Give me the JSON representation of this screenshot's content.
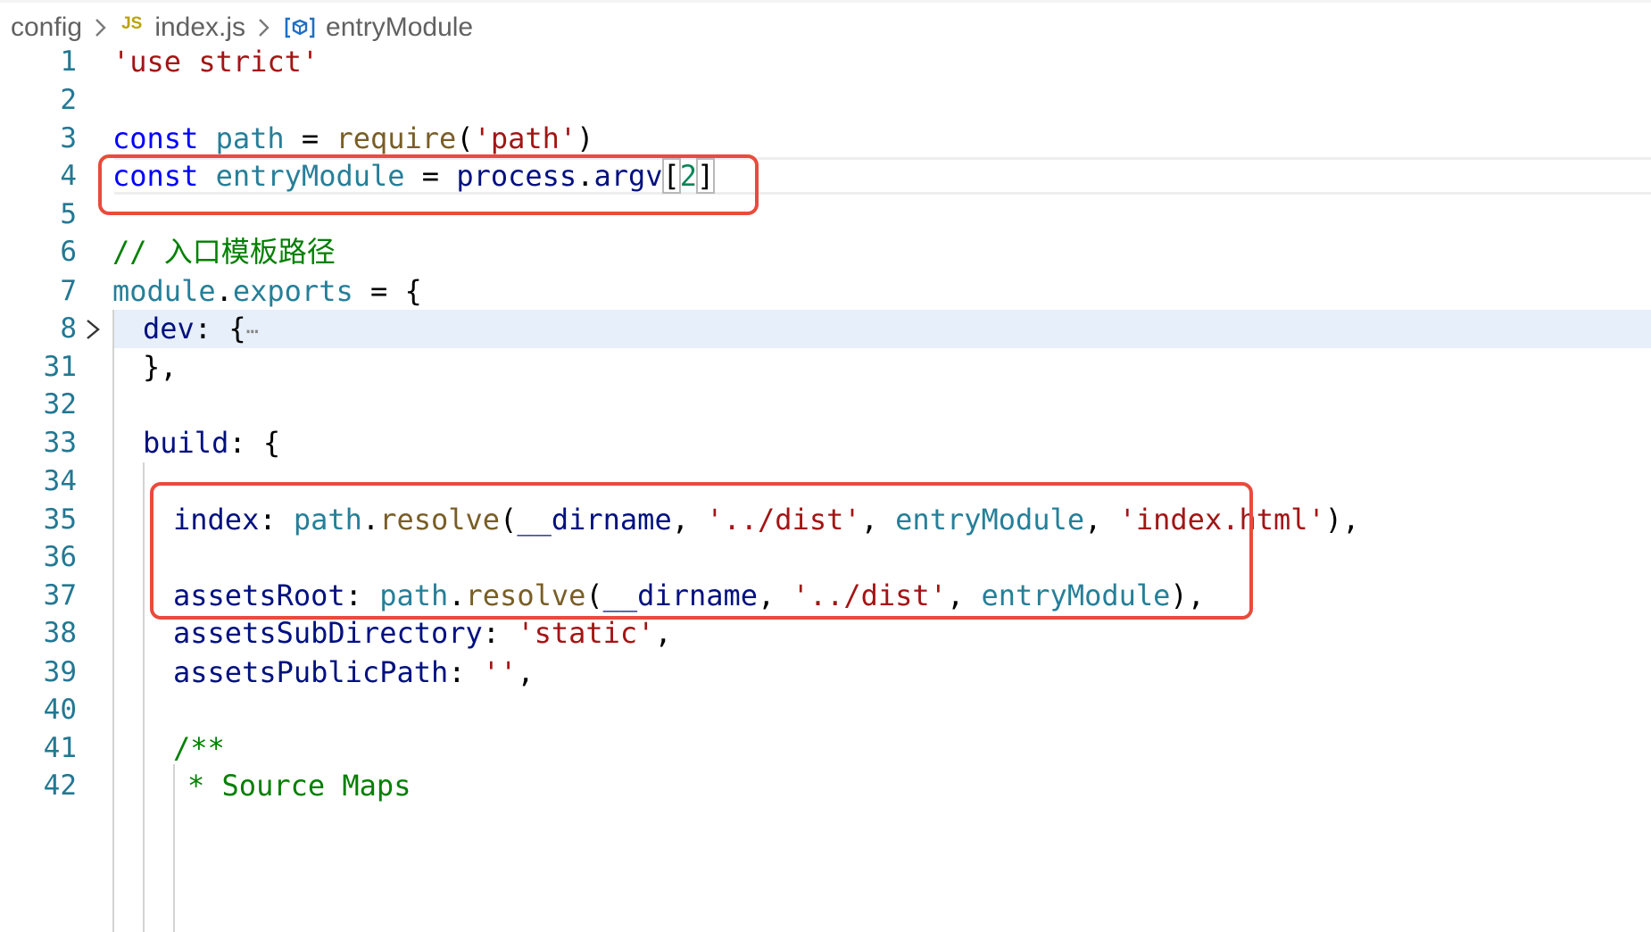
{
  "breadcrumb": {
    "folder": "config",
    "js_icon": "JS",
    "file": "index.js",
    "symbol": "entryModule"
  },
  "line_numbers": [
    "1",
    "2",
    "3",
    "4",
    "5",
    "6",
    "7",
    "8",
    "31",
    "32",
    "33",
    "34",
    "35",
    "36",
    "37",
    "38",
    "39",
    "40",
    "41",
    "42"
  ],
  "code": {
    "l1_str": "'use strict'",
    "kw_const": "const",
    "l3_var": "path",
    "l3_eq": " = ",
    "l3_fn": "require",
    "l3_open": "(",
    "l3_str": "'path'",
    "l3_close": ")",
    "l4_var": "entryModule",
    "l4_eq": " = ",
    "l4_obj": "process",
    "dot": ".",
    "l4_prop": "argv",
    "l4_lb": "[",
    "l4_num": "2",
    "l4_rb": "]",
    "l6_cmt": "// 入口模板路径",
    "l7_obj": "module",
    "l7_prop": "exports",
    "l7_rest": " = {",
    "l8_key": "dev",
    "l8_rest": ": {",
    "l8_ellipsis": "⋯",
    "l31_text": "},",
    "l33_key": "build",
    "l33_rest": ": {",
    "l35_key": "index",
    "l35_colon": ": ",
    "l35_obj": "path",
    "l35_fn": "resolve",
    "l35_open": "(",
    "l35_arg1": "__dirname",
    "comma": ", ",
    "l35_str1": "'../dist'",
    "l35_arg3": "entryModule",
    "l35_str2": "'index.html'",
    "l35_close": "),",
    "l37_key": "assetsRoot",
    "l37_colon": ": ",
    "l37_obj": "path",
    "l37_fn": "resolve",
    "l37_open": "(",
    "l37_arg1": "__dirname",
    "l37_str1": "'../dist'",
    "l37_arg3": "entryModule",
    "l37_close": "),",
    "l38_key": "assetsSubDirectory",
    "l38_colon": ": ",
    "l38_str": "'static'",
    "l38_end": ",",
    "l39_key": "assetsPublicPath",
    "l39_colon": ": ",
    "l39_str": "''",
    "l39_end": ",",
    "l41_cmt": "/**",
    "l42_cmt": "* Source Maps"
  },
  "colors": {
    "keyword": "#0000ff",
    "string": "#a31515",
    "variable": "#001080",
    "function": "#795e26",
    "comment": "#008000",
    "number": "#098658",
    "object": "#267f99",
    "line_number": "#237893",
    "annotation_box": "#e94b3c"
  },
  "icons": {
    "breadcrumb_separator": "chevron-right-icon",
    "symbol": "variable-symbol-icon",
    "fold": "chevron-right-icon"
  }
}
